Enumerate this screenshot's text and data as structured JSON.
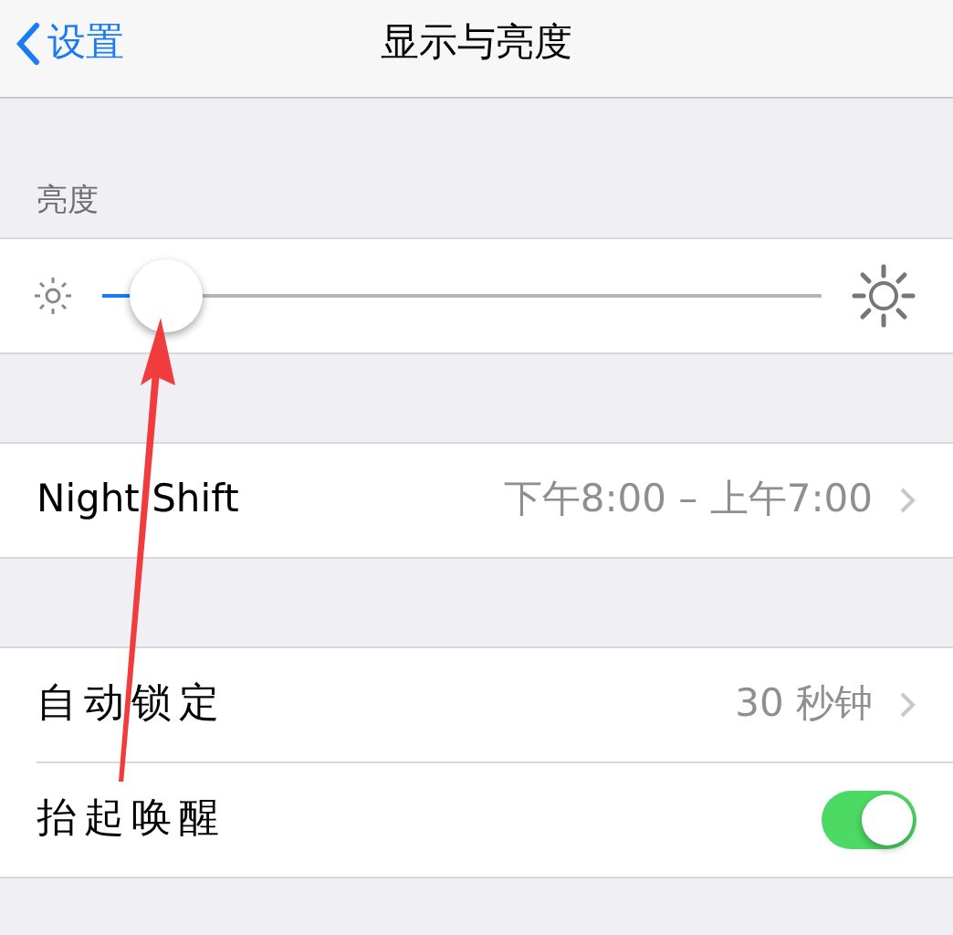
{
  "nav": {
    "back": "设置",
    "title": "显示与亮度"
  },
  "brightness": {
    "header": "亮度",
    "level": 0.09
  },
  "night_shift": {
    "label": "Night Shift",
    "value": "下午8:00 – 上午7:00"
  },
  "rows": [
    {
      "kind": "value",
      "label": "自动锁定",
      "value": "30 秒钟"
    },
    {
      "kind": "toggle",
      "label": "抬起唤醒",
      "on": true
    }
  ],
  "annotation": {
    "kind": "arrow"
  }
}
